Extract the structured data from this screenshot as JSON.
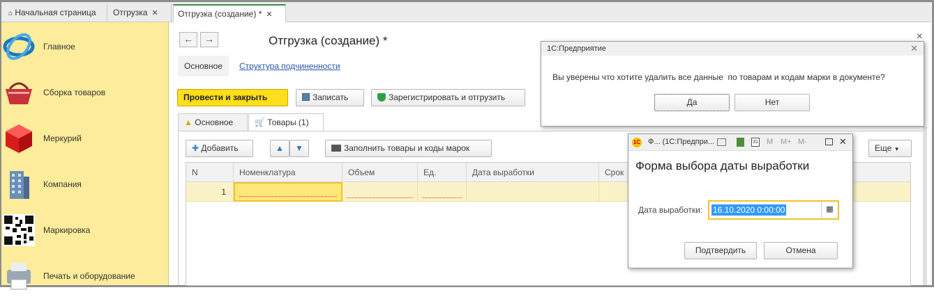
{
  "tabs": [
    {
      "label": "Начальная страница",
      "closable": false
    },
    {
      "label": "Отгрузка",
      "closable": true
    },
    {
      "label": "Отгрузка (создание) *",
      "closable": true,
      "active": true
    }
  ],
  "close_glyph": "✕",
  "sidebar": {
    "items": [
      {
        "label": "Главное",
        "icon": "globe-icon"
      },
      {
        "label": "Сборка товаров",
        "icon": "basket-icon"
      },
      {
        "label": "Меркурий",
        "icon": "cube-icon"
      },
      {
        "label": "Компания",
        "icon": "building-icon"
      },
      {
        "label": "Маркировка",
        "icon": "qr-code-icon"
      },
      {
        "label": "Печать и оборудование",
        "icon": "printer-icon"
      }
    ]
  },
  "document": {
    "back": "←",
    "forward": "→",
    "title": "Отгрузка (создание) *",
    "close": "×",
    "subtabs": {
      "main": "Основное",
      "structure": "Структура подчиненности"
    },
    "toolbar": {
      "post_close": "Провести и закрыть",
      "save": "Записать",
      "register": "Зарегистрировать и отгрузить"
    },
    "formtabs": {
      "main": "Основное",
      "goods": "Товары",
      "goods_count": "(1)"
    },
    "table_toolbar": {
      "add": "Добавить",
      "up": "▲",
      "down": "▼",
      "fill": "Заполнить товары и коды марок",
      "more": "Еще"
    },
    "columns": [
      "N",
      "Номенклатура",
      "Объем",
      "Ед.",
      "Дата выработки",
      "Срок"
    ],
    "rows": [
      {
        "n": "1"
      }
    ]
  },
  "confirm_dialog": {
    "title": "1С:Предприятие",
    "message": "Вы уверены что хотите удалить все данные  по товарам и кодам марки в документе?",
    "yes": "Да",
    "no": "Нет"
  },
  "date_dialog": {
    "window_title": "Ф...  (1С:Предпри...",
    "tools": [
      "M",
      "M+",
      "M-"
    ],
    "heading": "Форма выбора даты выработки",
    "field_label": "Дата выработки:",
    "field_value": "16.10.2020  0:00:00",
    "confirm": "Подтвердить",
    "cancel": "Отмена"
  },
  "colors": {
    "sidebar": "#fcec9b",
    "accent_button": "#ffde1b",
    "row_highlight": "#fbf3c7",
    "active_tab": "#3a8d4a"
  }
}
